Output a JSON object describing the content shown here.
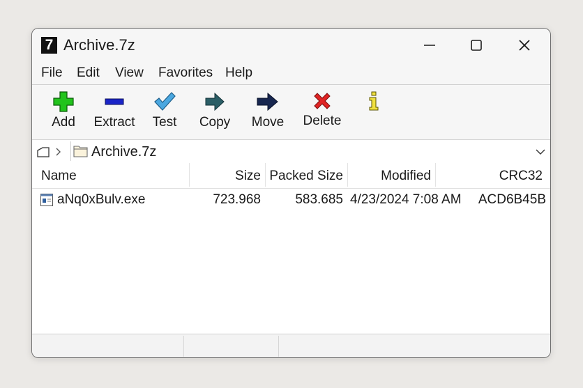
{
  "window": {
    "title": "Archive.7z",
    "app_icon_text": "7"
  },
  "menu": {
    "items": [
      "File",
      "Edit",
      "View",
      "Favorites",
      "Help"
    ]
  },
  "toolbar": {
    "buttons": [
      {
        "label": "Add",
        "icon": "add-icon",
        "color": "#22c31c"
      },
      {
        "label": "Extract",
        "icon": "extract-icon",
        "color": "#1a24c8"
      },
      {
        "label": "Test",
        "icon": "checkmark-icon",
        "color": "#4aa7e0"
      },
      {
        "label": "Copy",
        "icon": "arrow-right-icon",
        "color": "#2b5e66"
      },
      {
        "label": "Move",
        "icon": "arrow-right-icon",
        "color": "#17264f"
      },
      {
        "label": "Delete",
        "icon": "x-icon",
        "color": "#e02424"
      },
      {
        "label": "",
        "icon": "info-icon",
        "color": "#f0e040"
      }
    ]
  },
  "address": {
    "path": "Archive.7z"
  },
  "columns": [
    "Name",
    "Size",
    "Packed Size",
    "Modified",
    "CRC32"
  ],
  "files": [
    {
      "name": "aNq0xBulv.exe",
      "size": "723.968",
      "packed_size": "583.685",
      "modified": "4/23/2024 7:08 AM",
      "crc32": "ACD6B45B"
    }
  ]
}
